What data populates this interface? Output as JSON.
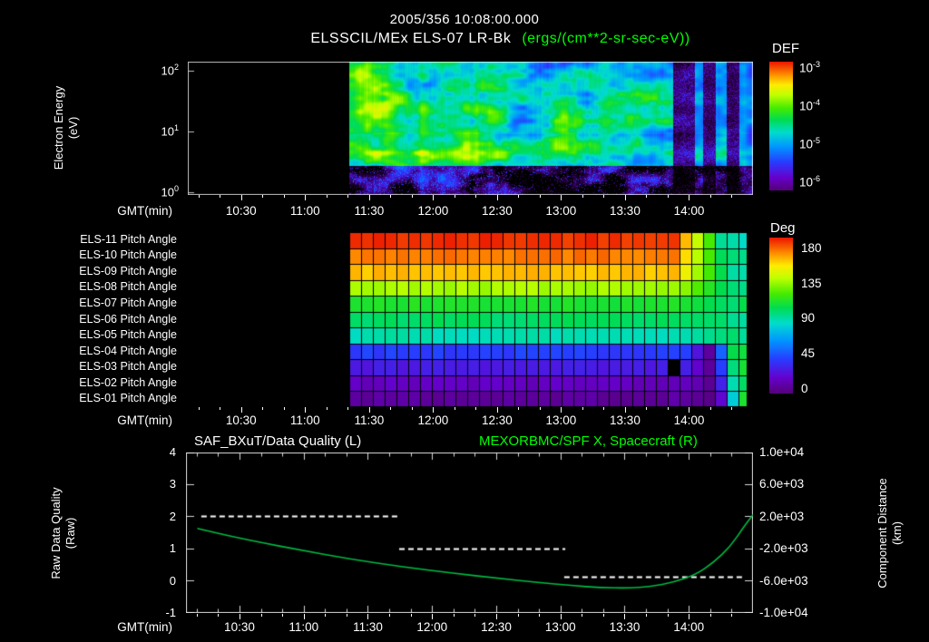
{
  "title": "2005/356 10:08:00.000",
  "subtitle": {
    "instrument": "ELSSCIL/MEx ELS-07 LR-Bk",
    "units": "(ergs/(cm**2-sr-sec-eV))"
  },
  "colors": {
    "background": "#000000",
    "text": "#ffffff",
    "accent_green": "#00ff00",
    "curve_green": "#00bb44"
  },
  "time_axis": {
    "label": "GMT(min)",
    "ticks": [
      "10:30",
      "11:00",
      "11:30",
      "12:00",
      "12:30",
      "13:00",
      "13:30",
      "14:00"
    ],
    "range_minutes": 265,
    "first_major_offset_min": 25,
    "major_interval_min": 30,
    "minor_interval_min": 10
  },
  "chart_data": [
    {
      "type": "heatmap",
      "name": "electron-energy-spectrogram",
      "title": "ELSSCIL/MEx ELS-07 LR-Bk (ergs/(cm**2-sr-sec-eV))",
      "xlabel": "GMT(min)",
      "x_ticks": [
        "10:30",
        "11:00",
        "11:30",
        "12:00",
        "12:30",
        "13:00",
        "13:30",
        "14:00"
      ],
      "ylabel_line1": "Electron Energy",
      "ylabel_line2": "(eV)",
      "y_scale": "log",
      "y_range_eV": [
        1,
        300
      ],
      "y_ticks": [
        {
          "b": "10",
          "e": "2"
        },
        {
          "b": "10",
          "e": "1"
        },
        {
          "b": "10",
          "e": "0"
        }
      ],
      "data_start_frac": 0.286,
      "dropout_frac": 0.8,
      "features": {
        "noise_floor_below_eV": 3,
        "bright_band_eV": [
          3,
          7
        ],
        "body": "green flux with yellow patches, dark blue dropout with green streaks after ~13:45"
      },
      "colorbar": {
        "title": "DEF",
        "ticks": [
          {
            "b": "10",
            "e": "-3"
          },
          {
            "b": "10",
            "e": "-4"
          },
          {
            "b": "10",
            "e": "-5"
          },
          {
            "b": "10",
            "e": "-6"
          }
        ]
      }
    },
    {
      "type": "heatmap",
      "name": "pitch-angle-panel",
      "xlabel": "GMT(min)",
      "x_ticks": [
        "10:30",
        "11:00",
        "11:30",
        "12:00",
        "12:30",
        "13:00",
        "13:30",
        "14:00"
      ],
      "rows": [
        "ELS-11 Pitch Angle",
        "ELS-10 Pitch Angle",
        "ELS-09 Pitch Angle",
        "ELS-08 Pitch Angle",
        "ELS-07 Pitch Angle",
        "ELS-06 Pitch Angle",
        "ELS-05 Pitch Angle",
        "ELS-04 Pitch Angle",
        "ELS-03 Pitch Angle",
        "ELS-02 Pitch Angle",
        "ELS-01 Pitch Angle"
      ],
      "row_angles_deg": [
        176,
        165,
        154,
        130,
        106,
        96,
        85,
        40,
        27,
        16,
        8
      ],
      "data_start_frac": 0.286,
      "data_end_frac": 0.989,
      "turn_frac": 0.8,
      "final_angle_deg": 95,
      "gap_cell": {
        "row": "ELS-03 Pitch Angle",
        "frac": 0.81
      },
      "colorbar": {
        "title": "Deg",
        "ticks": [
          "180",
          "135",
          "90",
          "45",
          "0"
        ]
      }
    },
    {
      "type": "line",
      "name": "quality-and-distance",
      "xlabel": "GMT(min)",
      "x_ticks": [
        "10:30",
        "11:00",
        "11:30",
        "12:00",
        "12:30",
        "13:00",
        "13:30",
        "14:00"
      ],
      "left_axis": {
        "label_line1": "Raw Data Quality",
        "label_line2": "(Raw)",
        "ticks": [
          "4",
          "3",
          "2",
          "1",
          "0",
          "-1"
        ],
        "range": [
          -1,
          4
        ]
      },
      "right_axis": {
        "label_line1": "Component Distance",
        "label_line2": "(km)",
        "ticks": [
          "1.0e+04",
          "6.0e+03",
          "2.0e+03",
          "-2.0e+03",
          "-6.0e+03",
          "-1.0e+04"
        ],
        "range": [
          -10000,
          10000
        ]
      },
      "series": [
        {
          "name": "SAF_BXuT/Data Quality (L)",
          "axis": "left",
          "style": "dashed",
          "color": "#ffffff",
          "steps": [
            {
              "value": 2,
              "t0": 0.027,
              "t1": 0.373
            },
            {
              "value": 1,
              "t0": 0.376,
              "t1": 0.669
            },
            {
              "value": 0.1,
              "t0": 0.667,
              "t1": 0.981
            }
          ]
        },
        {
          "name": "MEXORBMC/SPF X, Spacecraft (R)",
          "axis": "right",
          "style": "solid",
          "color": "#00bb44",
          "points": [
            [
              0.02,
              480
            ],
            [
              0.06,
              -200
            ],
            [
              0.12,
              -1120
            ],
            [
              0.2,
              -2200
            ],
            [
              0.29,
              -3360
            ],
            [
              0.38,
              -4320
            ],
            [
              0.47,
              -5120
            ],
            [
              0.55,
              -5760
            ],
            [
              0.62,
              -6280
            ],
            [
              0.68,
              -6680
            ],
            [
              0.73,
              -6920
            ],
            [
              0.78,
              -7000
            ],
            [
              0.82,
              -6800
            ],
            [
              0.86,
              -6280
            ],
            [
              0.9,
              -5280
            ],
            [
              0.93,
              -3800
            ],
            [
              0.96,
              -1800
            ],
            [
              0.985,
              800
            ],
            [
              1.0,
              2200
            ]
          ]
        }
      ]
    }
  ]
}
